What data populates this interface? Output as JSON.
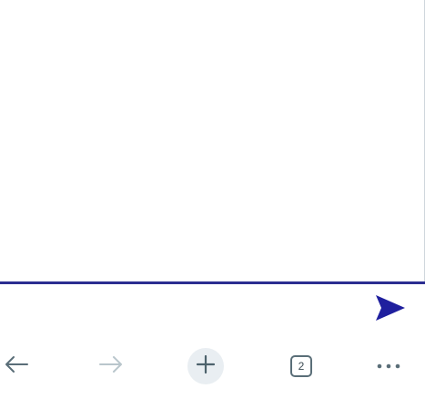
{
  "toolbar": {
    "tab_count": "2"
  },
  "icons": {
    "send": "send-icon",
    "back": "arrow-left-icon",
    "forward": "arrow-right-icon",
    "new_tab": "plus-icon",
    "tabs": "tabs-counter-icon",
    "more": "more-horizontal-icon"
  },
  "colors": {
    "accent": "#2b2d91",
    "send": "#1f1f9e",
    "icon_active": "#5a6e78",
    "icon_disabled": "#b9c6cc",
    "new_tab_bg": "#e9eef2"
  }
}
